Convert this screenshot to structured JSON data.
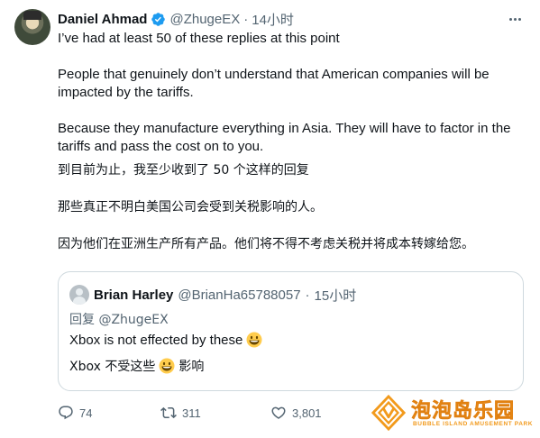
{
  "author": {
    "name": "Daniel Ahmad",
    "handle": "@ZhugeEX",
    "dot": "·",
    "time": "14小时"
  },
  "tweet": {
    "line1": "I’ve had at least 50 of these replies at this point",
    "line2": "People that genuinely don’t understand that American companies will be impacted by the tariffs.",
    "line3": "Because they manufacture everything in Asia. They will have to factor in the tariffs and pass the cost on to you.",
    "line4": "到目前为止，我至少收到了 50 个这样的回复",
    "line5": "那些真正不明白美国公司会受到关税影响的人。",
    "line6": "因为他们在亚洲生产所有产品。他们将不得不考虑关税并将成本转嫁给您。"
  },
  "quote": {
    "name": "Brian Harley",
    "handle": "@BrianHa65788057",
    "dot": "·",
    "time": "15小时",
    "reply_to": "回复 @ZhugeEX",
    "text1": "Xbox is not effected by these",
    "text2a": "Xbox 不受这些",
    "text2b": "影响"
  },
  "actions": {
    "replies": "74",
    "retweets": "311",
    "likes": "3,801"
  },
  "watermark": {
    "title": "泡泡岛乐园",
    "subtitle": "BUBBLE ISLAND AMUSEMENT PARK"
  },
  "colors": {
    "text": "#0f1419",
    "secondary": "#536471",
    "verified": "#1d9bf0",
    "border": "#cfd9de",
    "watermark": "#f29a1c"
  },
  "icons": [
    "verified-badge-icon",
    "more-icon",
    "reply-icon",
    "retweet-icon",
    "like-icon",
    "grinning-emoji-icon"
  ]
}
